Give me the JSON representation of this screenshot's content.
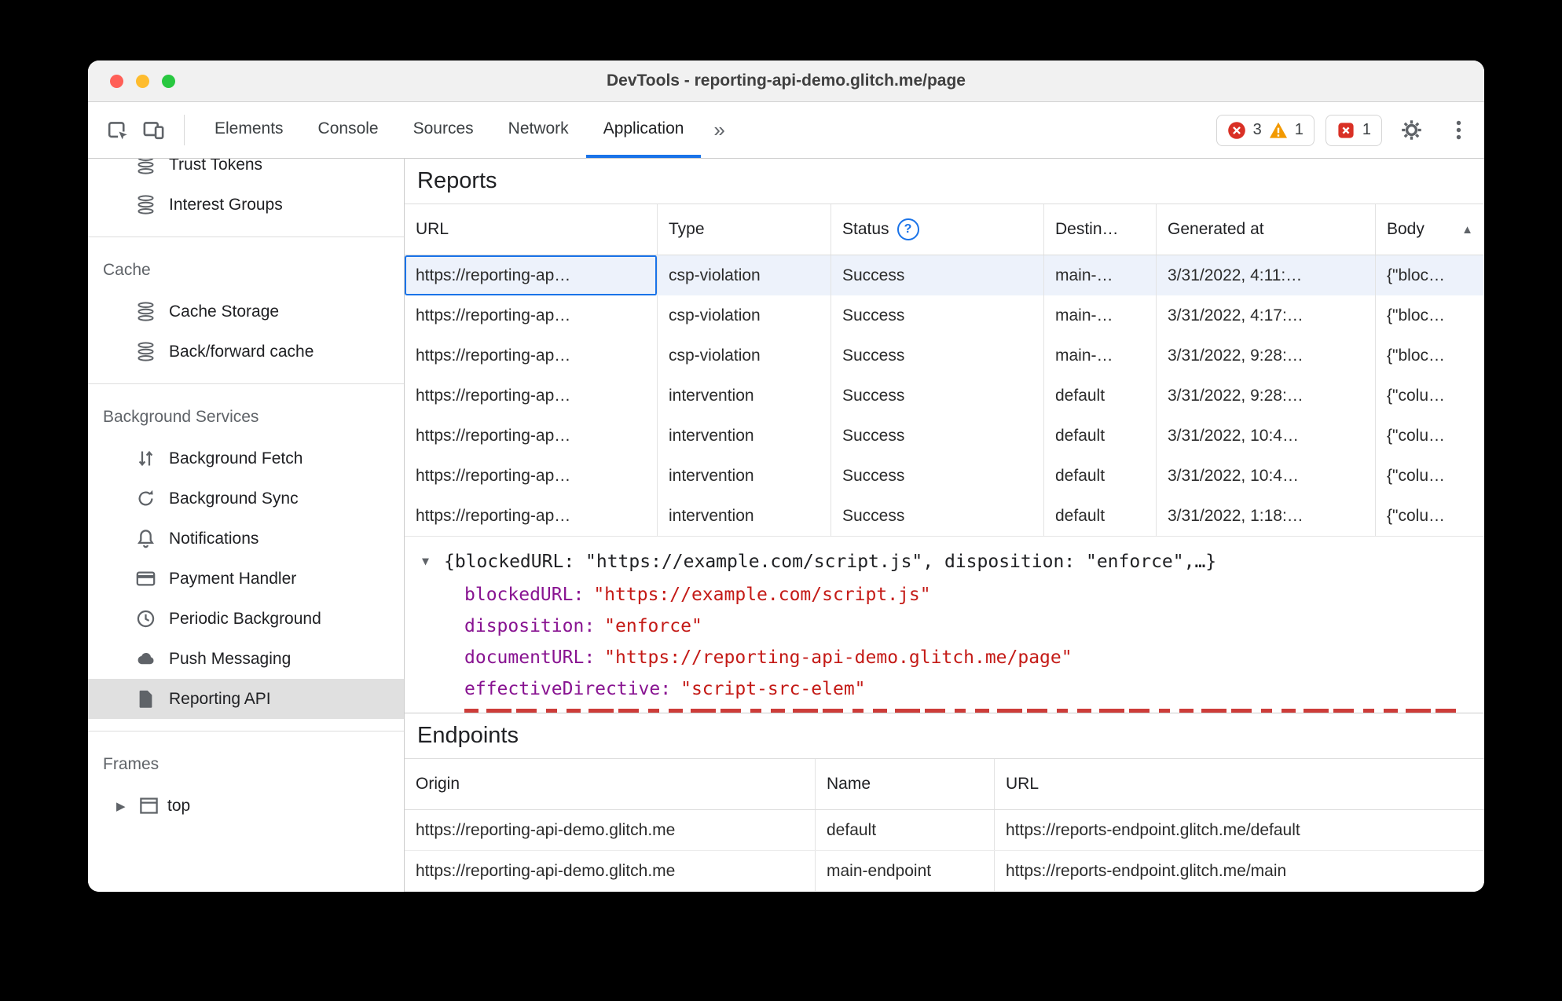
{
  "window": {
    "title": "DevTools - reporting-api-demo.glitch.me/page"
  },
  "toolbar": {
    "tabs": [
      "Elements",
      "Console",
      "Sources",
      "Network",
      "Application"
    ],
    "active_tab": "Application",
    "overflow_chevron": "»",
    "error_count": "3",
    "warning_count": "1",
    "issue_count": "1"
  },
  "sidebar": {
    "top_items": [
      {
        "label": "Trust Tokens",
        "icon": "database"
      },
      {
        "label": "Interest Groups",
        "icon": "database"
      }
    ],
    "sections": [
      {
        "title": "Cache",
        "items": [
          {
            "label": "Cache Storage",
            "icon": "database"
          },
          {
            "label": "Back/forward cache",
            "icon": "database"
          }
        ]
      },
      {
        "title": "Background Services",
        "items": [
          {
            "label": "Background Fetch",
            "icon": "fetch-arrows"
          },
          {
            "label": "Background Sync",
            "icon": "sync-arrows"
          },
          {
            "label": "Notifications",
            "icon": "bell"
          },
          {
            "label": "Payment Handler",
            "icon": "payment-card"
          },
          {
            "label": "Periodic Background",
            "icon": "clock"
          },
          {
            "label": "Push Messaging",
            "icon": "cloud"
          },
          {
            "label": "Reporting API",
            "icon": "document",
            "selected": true
          }
        ]
      },
      {
        "title": "Frames",
        "items": [
          {
            "label": "top",
            "icon": "frame",
            "expandable": true
          }
        ]
      }
    ]
  },
  "reports": {
    "title": "Reports",
    "columns": {
      "url": "URL",
      "type": "Type",
      "status": "Status",
      "destination": "Destin…",
      "generated": "Generated at",
      "body": "Body"
    },
    "rows": [
      {
        "url": "https://reporting-ap…",
        "type": "csp-violation",
        "status": "Success",
        "destination": "main-…",
        "generated": "3/31/2022, 4:11:…",
        "body": "{\"bloc…",
        "selected": true
      },
      {
        "url": "https://reporting-ap…",
        "type": "csp-violation",
        "status": "Success",
        "destination": "main-…",
        "generated": "3/31/2022, 4:17:…",
        "body": "{\"bloc…"
      },
      {
        "url": "https://reporting-ap…",
        "type": "csp-violation",
        "status": "Success",
        "destination": "main-…",
        "generated": "3/31/2022, 9:28:…",
        "body": "{\"bloc…"
      },
      {
        "url": "https://reporting-ap…",
        "type": "intervention",
        "status": "Success",
        "destination": "default",
        "generated": "3/31/2022, 9:28:…",
        "body": "{\"colu…"
      },
      {
        "url": "https://reporting-ap…",
        "type": "intervention",
        "status": "Success",
        "destination": "default",
        "generated": "3/31/2022, 10:4…",
        "body": "{\"colu…"
      },
      {
        "url": "https://reporting-ap…",
        "type": "intervention",
        "status": "Success",
        "destination": "default",
        "generated": "3/31/2022, 10:4…",
        "body": "{\"colu…"
      },
      {
        "url": "https://reporting-ap…",
        "type": "intervention",
        "status": "Success",
        "destination": "default",
        "generated": "3/31/2022, 1:18:…",
        "body": "{\"colu…"
      }
    ]
  },
  "preview": {
    "summary": "{blockedURL: \"https://example.com/script.js\", disposition: \"enforce\",…}",
    "fields": [
      {
        "key": "blockedURL:",
        "value": "\"https://example.com/script.js\""
      },
      {
        "key": "disposition:",
        "value": "\"enforce\""
      },
      {
        "key": "documentURL:",
        "value": "\"https://reporting-api-demo.glitch.me/page\""
      },
      {
        "key": "effectiveDirective:",
        "value": "\"script-src-elem\""
      }
    ]
  },
  "endpoints": {
    "title": "Endpoints",
    "columns": {
      "origin": "Origin",
      "name": "Name",
      "url": "URL"
    },
    "rows": [
      {
        "origin": "https://reporting-api-demo.glitch.me",
        "name": "default",
        "url": "https://reports-endpoint.glitch.me/default"
      },
      {
        "origin": "https://reporting-api-demo.glitch.me",
        "name": "main-endpoint",
        "url": "https://reports-endpoint.glitch.me/main"
      }
    ]
  },
  "colors": {
    "accent": "#1a73e8",
    "error": "#d93025",
    "warning": "#f29900",
    "json_key": "#881391",
    "json_string": "#c41a16"
  }
}
